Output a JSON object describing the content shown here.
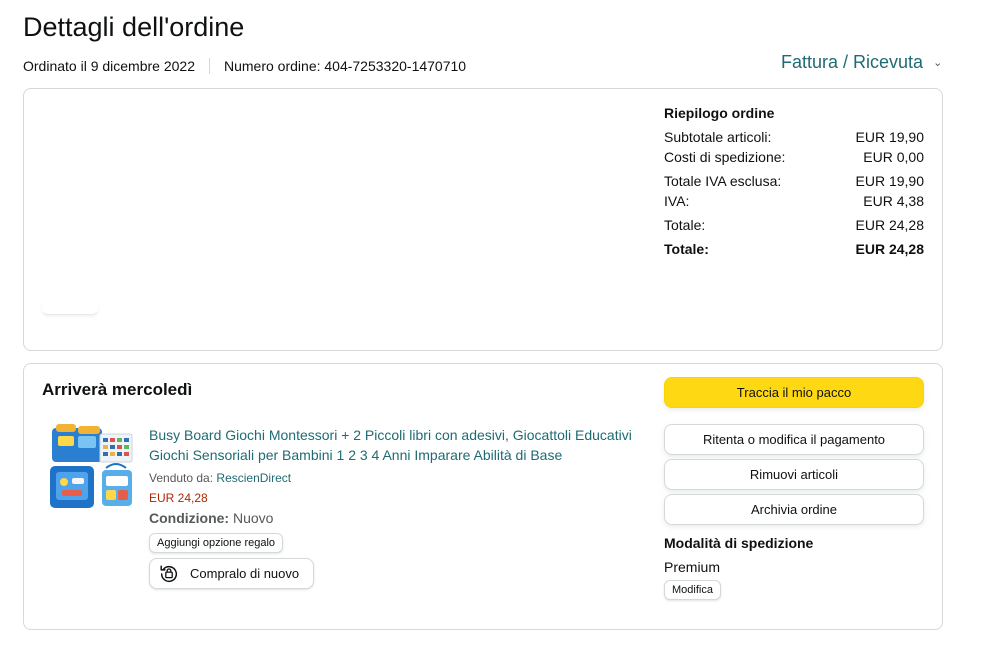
{
  "page": {
    "title": "Dettagli dell'ordine",
    "ordered_on": "Ordinato il 9 dicembre 2022",
    "order_number": "Numero ordine: 404-7253320-1470710",
    "invoice_link": "Fattura / Ricevuta"
  },
  "summary": {
    "heading": "Riepilogo ordine",
    "rows": [
      {
        "label": "Subtotale articoli:",
        "value": "EUR 19,90"
      },
      {
        "label": "Costi di spedizione:",
        "value": "EUR 0,00"
      },
      {
        "label": "Totale IVA esclusa:",
        "value": "EUR 19,90"
      },
      {
        "label": "IVA:",
        "value": "EUR 4,38"
      },
      {
        "label": "Totale:",
        "value": "EUR 24,28"
      },
      {
        "label": "Totale:",
        "value": "EUR 24,28"
      }
    ]
  },
  "shipment": {
    "status": "Arriverà mercoledì",
    "product": {
      "title": "Busy Board Giochi Montessori + 2 Piccoli libri con adesivi, Giocattoli Educativi Giochi Sensoriali per Bambini 1 2 3 4 Anni Imparare Abilità di Base",
      "seller_prefix": "Venduto da: ",
      "seller_name": "RescienDirect",
      "price": "EUR 24,28",
      "condition_label": "Condizione:",
      "condition_value": " Nuovo",
      "gift_button": "Aggiungi opzione regalo",
      "buy_again_button": "Compralo di nuovo"
    },
    "actions": {
      "track": "Traccia il mio pacco",
      "retry_payment": "Ritenta o modifica il pagamento",
      "remove_items": "Rimuovi articoli",
      "archive": "Archivia ordine"
    },
    "shipping_method": {
      "heading": "Modalità di spedizione",
      "value": "Premium",
      "change_button": "Modifica"
    }
  },
  "colors": {
    "link": "#1f6b73",
    "price": "#b12704",
    "primary_button": "#ffd814",
    "border": "#d5d9d9"
  }
}
